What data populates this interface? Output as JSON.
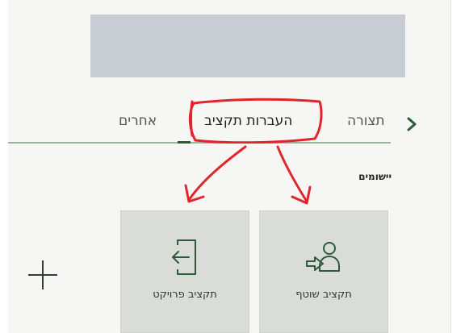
{
  "tabs": {
    "others": "אחרים",
    "budget_transfers": "העברות תקציב",
    "view": "תצורה"
  },
  "section": {
    "title": "יישומים"
  },
  "tiles": {
    "project_budget": "תקציב פרויקט",
    "current_budget": "תקציב שוטף"
  },
  "icons": {
    "tab_scroll": "chevron-right-icon",
    "add": "plus-icon",
    "project_budget": "sign-in-icon",
    "current_budget": "user-transfer-icon"
  },
  "colors": {
    "accent_green": "#2f5a3a",
    "annotation_red": "#e0262a"
  }
}
